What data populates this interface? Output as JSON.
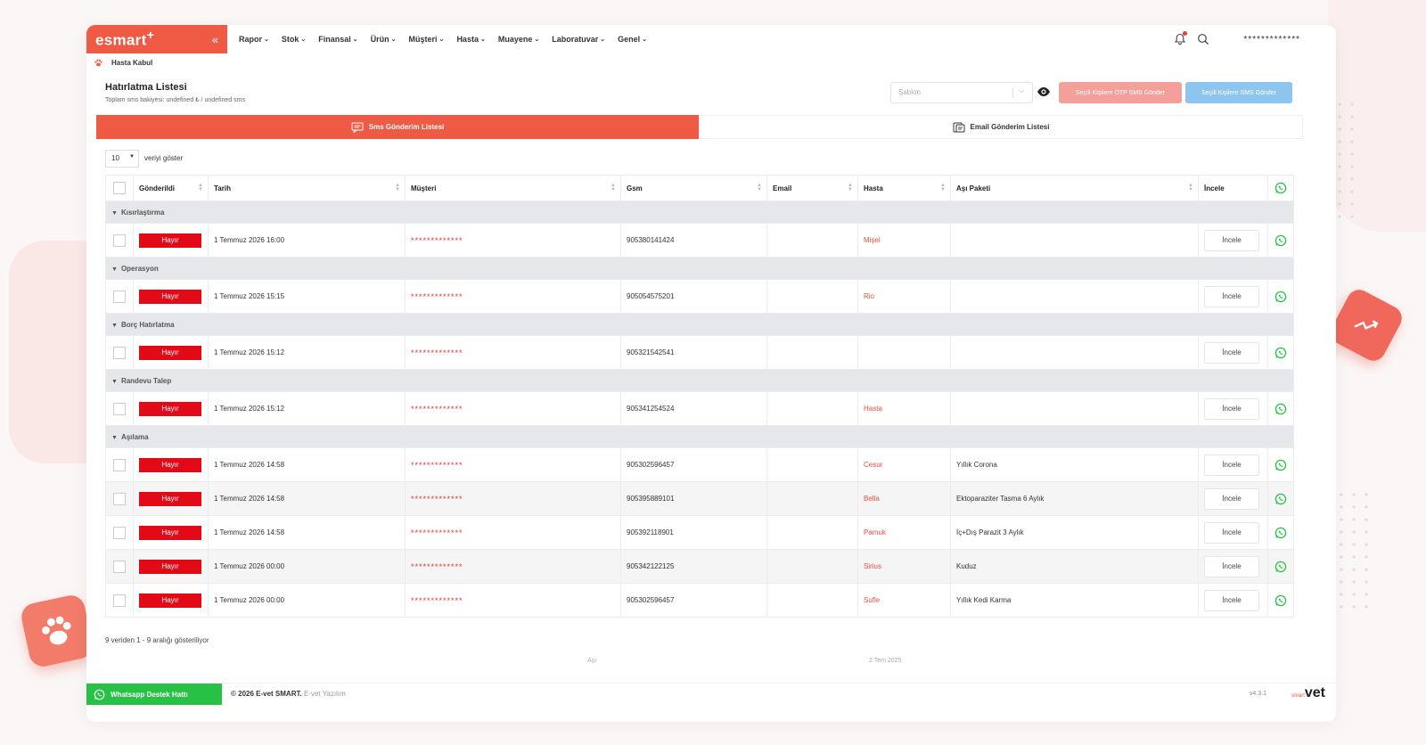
{
  "app": {
    "logo": "esmart",
    "logo_plus": "+",
    "user": "*************",
    "breadcrumb": "Hasta Kabul"
  },
  "menu": [
    {
      "label": "Rapor"
    },
    {
      "label": "Stok"
    },
    {
      "label": "Finansal"
    },
    {
      "label": "Ürün"
    },
    {
      "label": "Müşteri"
    },
    {
      "label": "Hasta"
    },
    {
      "label": "Muayene"
    },
    {
      "label": "Laboratuvar"
    },
    {
      "label": "Genel"
    }
  ],
  "page": {
    "title": "Hatırlatma Listesi",
    "subtitle": "Toplam sms bakiyesi: undefined ₺ / undefined sms",
    "template_placeholder": "Şablon",
    "otp_button": "Seçili Kişilere OTP SMS Gönder",
    "sms_button": "Seçili Kişilere SMS Gönder"
  },
  "tabs": {
    "sms": "Sms Gönderim Listesi",
    "email": "Email Gönderim Listesi"
  },
  "length": {
    "value": "10",
    "label": "veriyi göster"
  },
  "table": {
    "columns": [
      "Gönderildi",
      "Tarih",
      "Müşteri",
      "Gsm",
      "Email",
      "Hasta",
      "Aşı Paketi",
      "İncele"
    ],
    "inspect_label": "İncele",
    "groups": [
      {
        "name": "Kısırlaştırma",
        "rows": [
          {
            "sent": "Hayır",
            "date": "1 Temmuz 2026 16:00",
            "customer": "*************",
            "gsm": "905380141424",
            "email": "",
            "pet": "Mişel",
            "package": ""
          }
        ]
      },
      {
        "name": "Operasyon",
        "rows": [
          {
            "sent": "Hayır",
            "date": "1 Temmuz 2026 15:15",
            "customer": "*************",
            "gsm": "905054575201",
            "email": "",
            "pet": "Rio",
            "package": ""
          }
        ]
      },
      {
        "name": "Borç Hatırlatma",
        "rows": [
          {
            "sent": "Hayır",
            "date": "1 Temmuz 2026 15:12",
            "customer": "*************",
            "gsm": "905321542541",
            "email": "",
            "pet": "",
            "package": ""
          }
        ]
      },
      {
        "name": "Randevu Talep",
        "rows": [
          {
            "sent": "Hayır",
            "date": "1 Temmuz 2026 15:12",
            "customer": "*************",
            "gsm": "905341254524",
            "email": "",
            "pet": "Hasta",
            "package": ""
          }
        ]
      },
      {
        "name": "Aşılama",
        "rows": [
          {
            "sent": "Hayır",
            "date": "1 Temmuz 2026 14:58",
            "customer": "*************",
            "gsm": "905302596457",
            "email": "",
            "pet": "Cesur",
            "package": "Yıllık Corona"
          },
          {
            "sent": "Hayır",
            "date": "1 Temmuz 2026 14:58",
            "customer": "*************",
            "gsm": "905395889101",
            "email": "",
            "pet": "Bella",
            "package": "Ektoparaziter Tasma 6 Aylık"
          },
          {
            "sent": "Hayır",
            "date": "1 Temmuz 2026 14:58",
            "customer": "*************",
            "gsm": "905392118901",
            "email": "",
            "pet": "Pamuk",
            "package": "İç+Dış Parazit 3 Aylık"
          },
          {
            "sent": "Hayır",
            "date": "1 Temmuz 2026 00:00",
            "customer": "*************",
            "gsm": "905342122125",
            "email": "",
            "pet": "Sirius",
            "package": "Kuduz"
          },
          {
            "sent": "Hayır",
            "date": "1 Temmuz 2026 00:00",
            "customer": "*************",
            "gsm": "905302596457",
            "email": "",
            "pet": "Sufle",
            "package": "Yıllık Kedi Karma"
          }
        ]
      }
    ],
    "info": "9 veriden 1 - 9 aralığı gösteriliyor"
  },
  "behind": {
    "text1": "Aşı",
    "text2": "2 Tem 2025"
  },
  "footer": {
    "whatsapp": "Whatsapp Destek Hattı",
    "copyright_bold": "© 2026 E-vet SMART.",
    "copyright_rest": "E-vet Yazılım",
    "version": "v4.3.1",
    "brand_small": "smart",
    "brand": "vet"
  },
  "colors": {
    "accent": "#ee5a44",
    "badge_red": "#e30a17",
    "whatsapp_green": "#27c245",
    "sms_button_blue": "#8ec5ee"
  }
}
